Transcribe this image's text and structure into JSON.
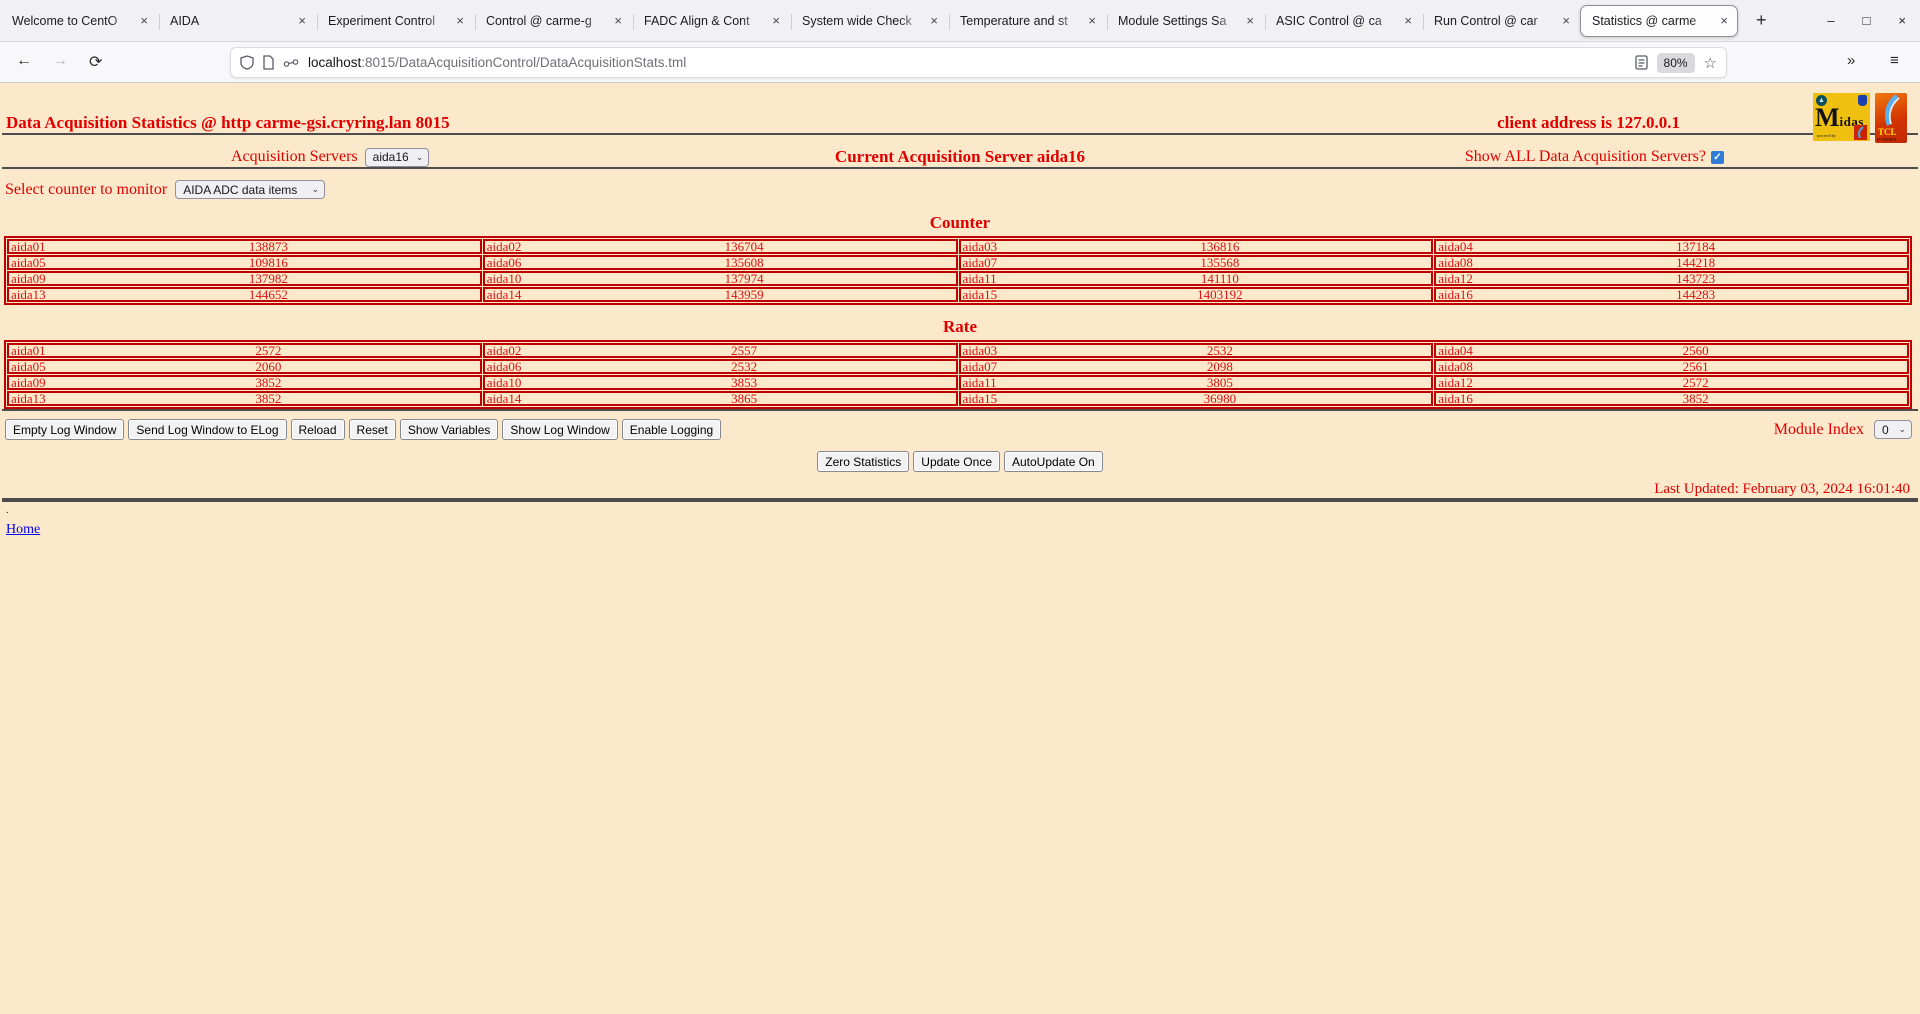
{
  "browser": {
    "tabs": [
      {
        "title": "Welcome to CentO"
      },
      {
        "title": "AIDA"
      },
      {
        "title": "Experiment Control"
      },
      {
        "title": "Control @ carme-g"
      },
      {
        "title": "FADC Align & Cont"
      },
      {
        "title": "System wide Check"
      },
      {
        "title": "Temperature and st"
      },
      {
        "title": "Module Settings Sa"
      },
      {
        "title": "ASIC Control @ ca"
      },
      {
        "title": "Run Control @ car"
      },
      {
        "title": "Statistics @ carme"
      }
    ],
    "active_tab_index": 10,
    "tab_close_glyph": "×",
    "new_tab_glyph": "+",
    "window_controls": [
      {
        "name": "minimize",
        "glyph": "–"
      },
      {
        "name": "maximize",
        "glyph": "□"
      },
      {
        "name": "close-window",
        "glyph": "×"
      }
    ],
    "nav": {
      "back": "←",
      "forward": "→",
      "reload": "⟳",
      "overflow": "»",
      "menu": "≡",
      "star": "☆"
    },
    "url": {
      "domain": "localhost",
      "rest": ":8015/DataAcquisitionControl/DataAcquisitionStats.tml"
    },
    "zoom_level": "80%"
  },
  "page": {
    "title": "Data Acquisition Statistics @ http carme-gsi.cryring.lan 8015",
    "client_address": "client address is 127.0.0.1",
    "acquisition_servers_label": "Acquisition Servers",
    "acquisition_server_selected": "aida16",
    "current_server_text": "Current Acquisition Server aida16",
    "show_all_label": "Show ALL Data Acquisition Servers?",
    "show_all_checked": true,
    "check_glyph": "✓",
    "chevron_glyph": "⌄",
    "counter_select_label": "Select counter to monitor",
    "counter_select_value": "AIDA ADC data items",
    "counter_title": "Counter",
    "rate_title": "Rate",
    "buttons_left": [
      "Empty Log Window",
      "Send Log Window to ELog",
      "Reload",
      "Reset",
      "Show Variables",
      "Show Log Window",
      "Enable Logging"
    ],
    "module_index_label": "Module Index",
    "module_index_value": "0",
    "buttons_center": [
      "Zero Statistics",
      "Update Once",
      "AutoUpdate On"
    ],
    "last_updated": "Last Updated: February 03, 2024 16:01:40",
    "dot": ".",
    "home_link": "Home",
    "logos": {
      "midas_m": "M",
      "midas_idas": "idas",
      "midas_powered": "powered by",
      "tcl": "TCL",
      "tcl_sub": "POWERED"
    }
  },
  "chart_data": {
    "type": "table",
    "counter": {
      "title": "Counter",
      "rows": [
        [
          {
            "n": "aida01",
            "v": "138873"
          },
          {
            "n": "aida02",
            "v": "136704"
          },
          {
            "n": "aida03",
            "v": "136816"
          },
          {
            "n": "aida04",
            "v": "137184"
          }
        ],
        [
          {
            "n": "aida05",
            "v": "109816"
          },
          {
            "n": "aida06",
            "v": "135608"
          },
          {
            "n": "aida07",
            "v": "135568"
          },
          {
            "n": "aida08",
            "v": "144218"
          }
        ],
        [
          {
            "n": "aida09",
            "v": "137982"
          },
          {
            "n": "aida10",
            "v": "137974"
          },
          {
            "n": "aida11",
            "v": "141110"
          },
          {
            "n": "aida12",
            "v": "143723"
          }
        ],
        [
          {
            "n": "aida13",
            "v": "144652"
          },
          {
            "n": "aida14",
            "v": "143959"
          },
          {
            "n": "aida15",
            "v": "1403192"
          },
          {
            "n": "aida16",
            "v": "144283"
          }
        ]
      ]
    },
    "rate": {
      "title": "Rate",
      "rows": [
        [
          {
            "n": "aida01",
            "v": "2572"
          },
          {
            "n": "aida02",
            "v": "2557"
          },
          {
            "n": "aida03",
            "v": "2532"
          },
          {
            "n": "aida04",
            "v": "2560"
          }
        ],
        [
          {
            "n": "aida05",
            "v": "2060"
          },
          {
            "n": "aida06",
            "v": "2532"
          },
          {
            "n": "aida07",
            "v": "2098"
          },
          {
            "n": "aida08",
            "v": "2561"
          }
        ],
        [
          {
            "n": "aida09",
            "v": "3852"
          },
          {
            "n": "aida10",
            "v": "3853"
          },
          {
            "n": "aida11",
            "v": "3805"
          },
          {
            "n": "aida12",
            "v": "2572"
          }
        ],
        [
          {
            "n": "aida13",
            "v": "3852"
          },
          {
            "n": "aida14",
            "v": "3865"
          },
          {
            "n": "aida15",
            "v": "36980"
          },
          {
            "n": "aida16",
            "v": "3852"
          }
        ]
      ]
    },
    "colors": {
      "page_background": "#fce9cb",
      "text_red": "#e00000",
      "table_border": "#bf0000",
      "link_blue": "#0000ee"
    }
  }
}
